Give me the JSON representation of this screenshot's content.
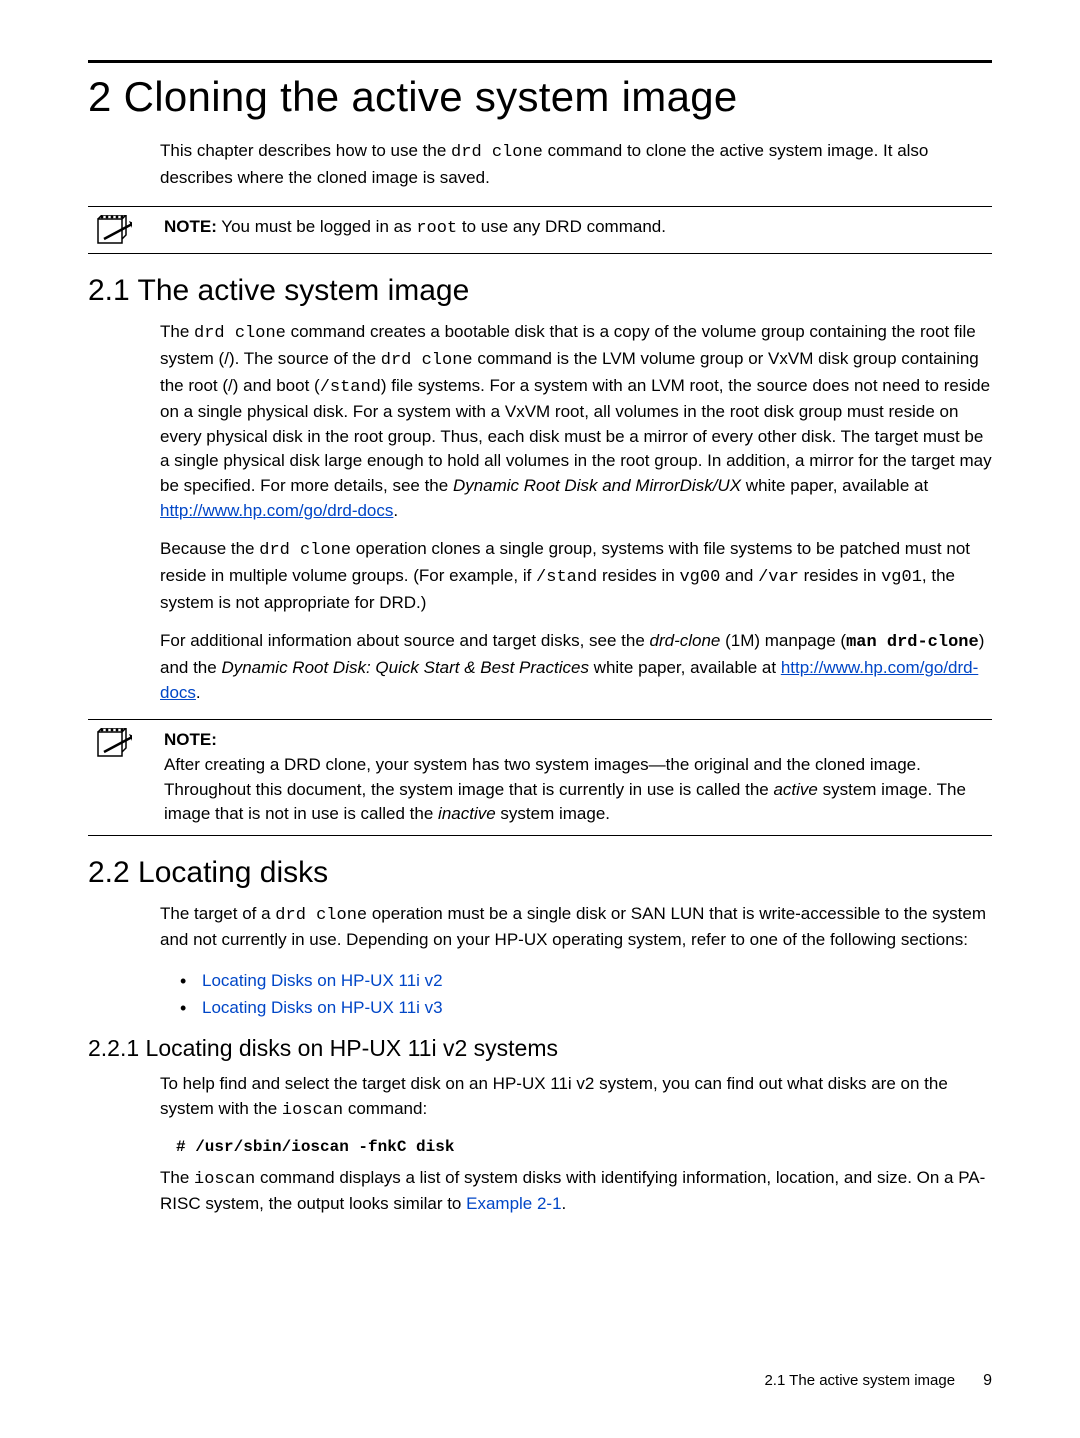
{
  "chapter": {
    "title": "2 Cloning the active system image"
  },
  "intro": {
    "prefix": "This chapter describes how to use the ",
    "cmd": "drd clone",
    "suffix": " command to clone the active system image. It also describes where the cloned image is saved."
  },
  "note1": {
    "label": "NOTE:",
    "prefix": "    You must be logged in as ",
    "mono": "root",
    "suffix": " to use any DRD command."
  },
  "sec21": {
    "heading": "2.1 The active system image",
    "p1": {
      "t1": "The ",
      "m1": "drd clone",
      "t2": " command creates a bootable disk that is a copy of the volume group containing the root file system (/). The source of the ",
      "m2": "drd clone",
      "t3": " command is the LVM volume group or VxVM disk group containing the root (/) and boot (",
      "m3": "/stand",
      "t4": ") file systems. For a system with an LVM root, the source does not need to reside on a single physical disk. For a system with a VxVM root, all volumes in the root disk group must reside on every physical disk in the root group. Thus, each disk must be a mirror of every other disk. The target must be a single physical disk large enough to hold all volumes in the root group. In addition, a mirror for the target may be specified. For more details, see the ",
      "i1": "Dynamic Root Disk and MirrorDisk/UX",
      "t5": " white paper, available at ",
      "link1": "http://www.hp.com/go/drd-docs",
      "t6": "."
    },
    "p2": {
      "t1": "Because the ",
      "m1": "drd clone",
      "t2": " operation clones a single group, systems with file systems to be patched must not reside in multiple volume groups. (For example, if ",
      "m2": "/stand",
      "t3": " resides in ",
      "m3": "vg00",
      "t4": " and ",
      "m4": "/var",
      "t5": " resides in ",
      "m5": "vg01",
      "t6": ", the system is not appropriate for DRD.)"
    },
    "p3": {
      "t1": "For additional information about source and target disks, see the ",
      "i1": "drd-clone",
      "t2": " (1M) manpage (",
      "bm1": "man drd-clone",
      "t3": ") and the ",
      "i2": "Dynamic Root Disk: Quick Start & Best Practices",
      "t4": " white paper, available at ",
      "link1": "http://www.hp.com/go/drd-docs",
      "t5": "."
    }
  },
  "note2": {
    "label": "NOTE:",
    "t1": "After creating a DRD clone, your system has two system images—the original and the cloned image. Throughout this document, the system image that is currently in use is called the ",
    "i1": "active",
    "t2": " system image. The image that is not in use is called the ",
    "i2": "inactive",
    "t3": " system image."
  },
  "sec22": {
    "heading": "2.2 Locating disks",
    "p1": {
      "t1": "The target of a ",
      "m1": "drd clone",
      "t2": " operation must be a single disk or SAN LUN that is write-accessible to the system and not currently in use. Depending on your HP-UX operating system, refer to one of the following sections:"
    },
    "bullets": [
      "Locating Disks on HP-UX 11i v2",
      "Locating Disks on HP-UX 11i v3"
    ]
  },
  "sec221": {
    "heading": "2.2.1 Locating disks on HP-UX 11i v2 systems",
    "p1": {
      "t1": "To help find and select the target disk on an HP-UX 11i v2 system, you can find out what disks are on the system with the ",
      "m1": "ioscan",
      "t2": " command:"
    },
    "cmd": "# /usr/sbin/ioscan -fnkC disk",
    "p2": {
      "t1": "The ",
      "m1": "ioscan",
      "t2": " command displays a list of system disks with identifying information, location, and size. On a PA-RISC system, the output looks similar to ",
      "link1": "Example 2-1",
      "t3": "."
    }
  },
  "footer": {
    "section": "2.1 The active system image",
    "page": "9"
  }
}
